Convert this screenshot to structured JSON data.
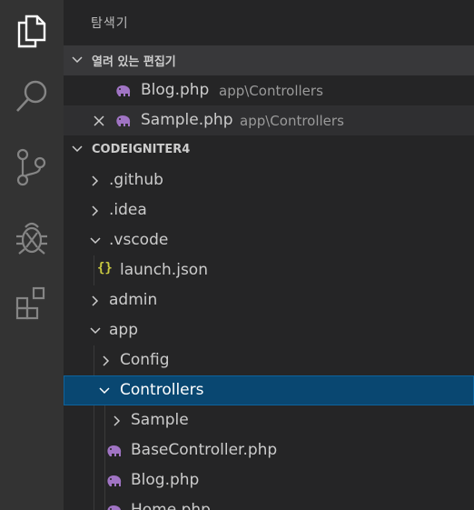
{
  "activity_bar": {
    "icons": [
      "explorer-icon",
      "search-icon",
      "source-control-icon",
      "debug-icon",
      "extensions-icon"
    ]
  },
  "explorer": {
    "title": "탐색기",
    "open_editors": {
      "label": "열려 있는 편집기",
      "items": [
        {
          "name": "Blog.php",
          "path": "app\\Controllers"
        },
        {
          "name": "Sample.php",
          "path": "app\\Controllers"
        }
      ]
    },
    "workspace": {
      "label": "CODEIGNITER4",
      "tree": [
        {
          "label": ".github"
        },
        {
          "label": ".idea"
        },
        {
          "label": ".vscode"
        },
        {
          "label": "launch.json"
        },
        {
          "label": "admin"
        },
        {
          "label": "app"
        },
        {
          "label": "Config"
        },
        {
          "label": "Controllers"
        },
        {
          "label": "Sample"
        },
        {
          "label": "BaseController.php"
        },
        {
          "label": "Blog.php"
        },
        {
          "label": "Home.php"
        }
      ]
    }
  },
  "colors": {
    "activity_bar": "#333333",
    "sidebar": "#252526",
    "selection": "#094771",
    "php_icon": "#a074c4",
    "json_icon": "#cbcb41"
  }
}
